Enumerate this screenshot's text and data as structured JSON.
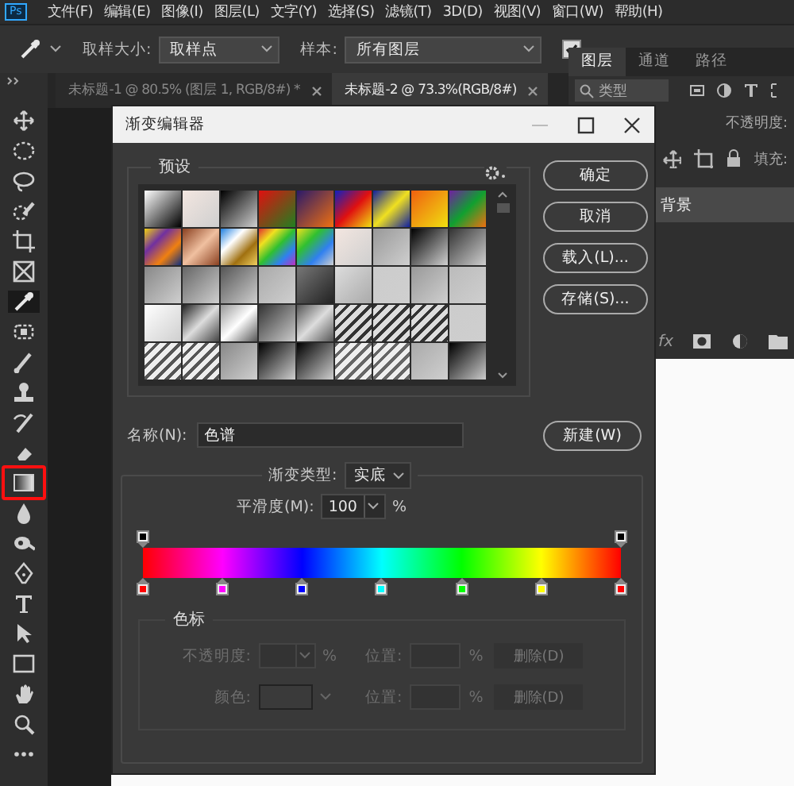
{
  "app_logo": "Ps",
  "menu": [
    "文件(F)",
    "编辑(E)",
    "图像(I)",
    "图层(L)",
    "文字(Y)",
    "选择(S)",
    "滤镜(T)",
    "3D(D)",
    "视图(V)",
    "窗口(W)",
    "帮助(H)"
  ],
  "options": {
    "size_label": "取样大小:",
    "size_value": "取样点",
    "sample_label": "样本:",
    "sample_value": "所有图层",
    "checked": true
  },
  "doc_tabs": [
    {
      "label": "未标题-1 @ 80.5% (图层 1, RGB/8#) *",
      "selected": false
    },
    {
      "label": "未标题-2 @ 73.3%(RGB/8#)",
      "selected": true
    }
  ],
  "tools": [
    {
      "kind": "move",
      "selected": false,
      "highlighted": false
    },
    {
      "kind": "marquee",
      "selected": false,
      "highlighted": false
    },
    {
      "kind": "lasso",
      "selected": false,
      "highlighted": false
    },
    {
      "kind": "quick-select",
      "selected": false,
      "highlighted": false
    },
    {
      "kind": "crop",
      "selected": false,
      "highlighted": false
    },
    {
      "kind": "frame",
      "selected": false,
      "highlighted": false
    },
    {
      "kind": "eyedropper",
      "selected": true,
      "highlighted": false
    },
    {
      "kind": "healing",
      "selected": false,
      "highlighted": false
    },
    {
      "kind": "brush",
      "selected": false,
      "highlighted": false
    },
    {
      "kind": "stamp",
      "selected": false,
      "highlighted": false
    },
    {
      "kind": "history-brush",
      "selected": false,
      "highlighted": false
    },
    {
      "kind": "eraser",
      "selected": false,
      "highlighted": false
    },
    {
      "kind": "gradient",
      "selected": false,
      "highlighted": true
    },
    {
      "kind": "blur",
      "selected": false,
      "highlighted": false
    },
    {
      "kind": "dodge",
      "selected": false,
      "highlighted": false
    },
    {
      "kind": "pen",
      "selected": false,
      "highlighted": false
    },
    {
      "kind": "type",
      "selected": false,
      "highlighted": false
    },
    {
      "kind": "path-select",
      "selected": false,
      "highlighted": false
    },
    {
      "kind": "rectangle",
      "selected": false,
      "highlighted": false
    },
    {
      "kind": "hand",
      "selected": false,
      "highlighted": false
    },
    {
      "kind": "zoom",
      "selected": false,
      "highlighted": false
    },
    {
      "kind": "more",
      "selected": false,
      "highlighted": false
    }
  ],
  "panel": {
    "tabs": [
      {
        "label": "图层",
        "selected": true
      },
      {
        "label": "通道",
        "selected": false
      },
      {
        "label": "路径",
        "selected": false
      }
    ],
    "search_placeholder": "类型",
    "opacity_label": "不透明度:",
    "fill_label": "填充:",
    "layers": [
      {
        "name": "背景",
        "selected": true
      }
    ],
    "fx_label": "fx"
  },
  "dialog": {
    "title": "渐变编辑器",
    "presets_label": "预设",
    "buttons": [
      "确定",
      "取消",
      "载入(L)...",
      "存储(S)..."
    ],
    "name_label": "名称(N):",
    "name_value": "色谱",
    "new_button": "新建(W)",
    "type_label": "渐变类型:",
    "type_value": "实底",
    "smooth_label": "平滑度(M):",
    "smooth_value": "100",
    "smooth_unit": "%",
    "opacity_stops": [
      {
        "color": "#000000"
      },
      {
        "color": "#000000"
      }
    ],
    "color_stops": [
      {
        "color": "#ff0000"
      },
      {
        "color": "#ff00ff"
      },
      {
        "color": "#0000ff"
      },
      {
        "color": "#00ffff"
      },
      {
        "color": "#00ff00"
      },
      {
        "color": "#ffff00"
      },
      {
        "color": "#ff0000"
      }
    ],
    "stops_label": "色标",
    "stop_rows": [
      {
        "kind": "opacity",
        "label": "不透明度:",
        "unit": "%",
        "location_label": "位置:",
        "location_unit": "%",
        "delete_label": "删除(D)",
        "disabled": true
      },
      {
        "kind": "color",
        "label": "颜色:",
        "location_label": "位置:",
        "location_unit": "%",
        "delete_label": "删除(D)",
        "disabled": true
      }
    ]
  }
}
